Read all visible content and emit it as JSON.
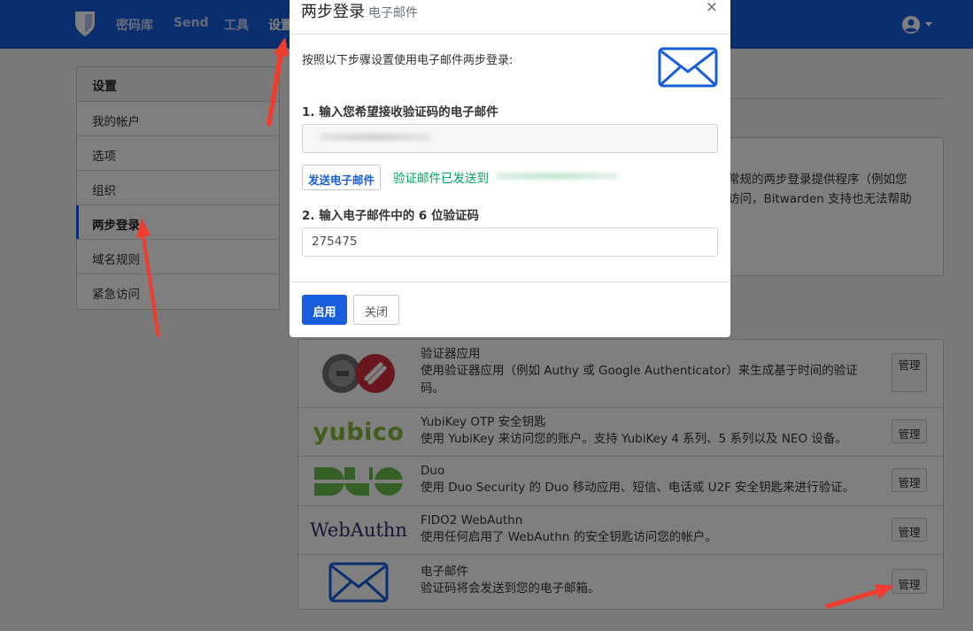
{
  "navbar": {
    "links": [
      "密码库",
      "Send",
      "工具",
      "设置"
    ],
    "active_link": "设置"
  },
  "sidebar": {
    "title": "设置",
    "items": [
      {
        "label": "我的帐户"
      },
      {
        "label": "选项"
      },
      {
        "label": "组织"
      },
      {
        "label": "两步登录",
        "active": true
      },
      {
        "label": "域名规则"
      },
      {
        "label": "紧急访问"
      }
    ]
  },
  "warning": {
    "text_line1": "常规的两步登录提供程序（例如您",
    "text_line2": "访问，Bitwarden 支持也无法帮助"
  },
  "providers": [
    {
      "icon": "authenticator-app-logo",
      "title": "验证器应用",
      "desc": "使用验证器应用（例如 Authy 或 Google Authenticator）来生成基于时间的验证码。",
      "manage_label": "管理"
    },
    {
      "icon": "yubico-logo",
      "logo_text": "yubico",
      "title": "YubiKey OTP 安全钥匙",
      "desc": "使用 YubiKey 来访问您的账户。支持 YubiKey 4 系列、5 系列以及 NEO 设备。",
      "manage_label": "管理"
    },
    {
      "icon": "duo-logo",
      "title": "Duo",
      "desc": "使用 Duo Security 的 Duo 移动应用、短信、电话或 U2F 安全钥匙来进行验证。",
      "manage_label": "管理"
    },
    {
      "icon": "webauthn-logo",
      "logo_text": "WebAuthn",
      "title": "FIDO2 WebAuthn",
      "desc": "使用任何启用了 WebAuthn 的安全钥匙访问您的帐户。",
      "manage_label": "管理"
    },
    {
      "icon": "envelope-icon",
      "title": "电子邮件",
      "desc": "验证码将会发送到您的电子邮箱。",
      "manage_label": "管理"
    }
  ],
  "modal": {
    "title": "两步登录",
    "subtitle": "电子邮件",
    "close_glyph": "×",
    "intro": "按照以下步骤设置使用电子邮件两步登录:",
    "step1_label": "1. 输入您希望接收验证码的电子邮件",
    "email_value": "",
    "send_button": "发送电子邮件",
    "sent_message": "验证邮件已发送到",
    "step2_label": "2. 输入电子邮件中的 6 位验证码",
    "code_value": "275475",
    "enable_button": "启用",
    "close_button": "关闭"
  },
  "colors": {
    "brand": "#175ddc",
    "success": "#00a65a",
    "annotation": "#f03c2e"
  }
}
